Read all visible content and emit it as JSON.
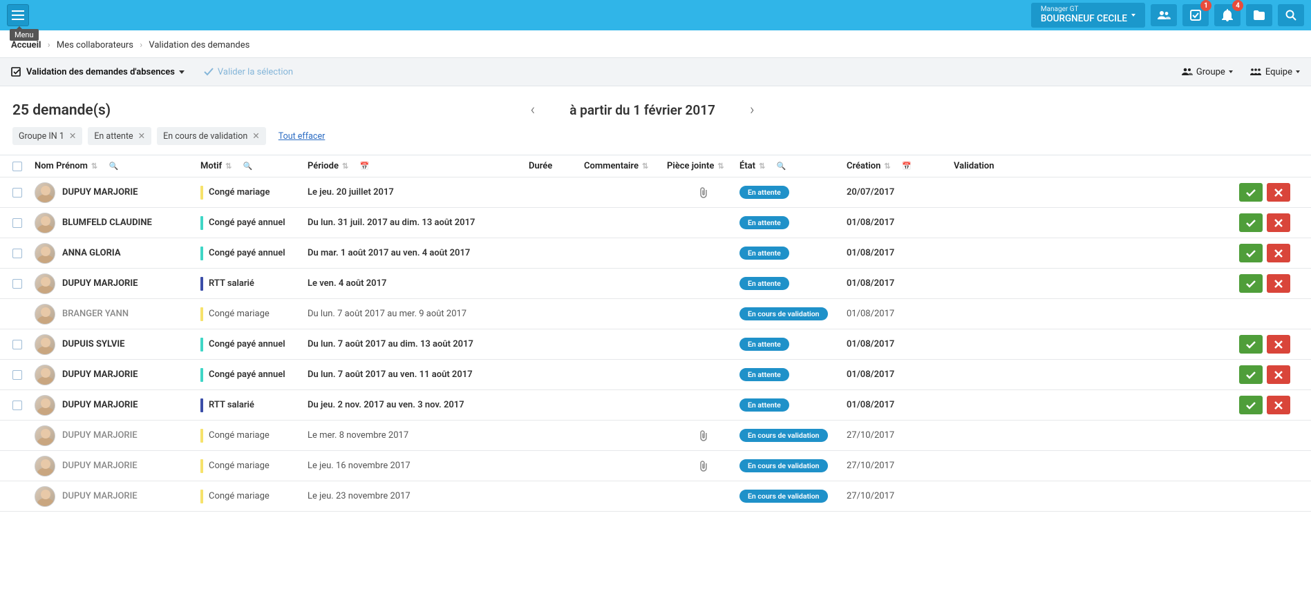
{
  "tooltip_menu": "Menu",
  "user": {
    "role": "Manager GT",
    "name": "BOURGNEUF CECILE"
  },
  "notif_badges": {
    "messages": "1",
    "bell": "4"
  },
  "breadcrumb": [
    "Accueil",
    "Mes collaborateurs",
    "Validation des demandes"
  ],
  "toolbar": {
    "main_action": "Validation des demandes d'absences",
    "validate_selection": "Valider la sélection",
    "group": "Groupe",
    "team": "Equipe"
  },
  "count_title": "25 demande(s)",
  "date_label": "à partir du 1 février 2017",
  "chips": [
    "Groupe IN 1",
    "En attente",
    "En cours de validation"
  ],
  "clear_all": "Tout effacer",
  "columns": {
    "name": "Nom Prénom",
    "motif": "Motif",
    "period": "Période",
    "duration": "Durée",
    "comment": "Commentaire",
    "attachment": "Pièce jointe",
    "state": "État",
    "creation": "Création",
    "validation": "Validation"
  },
  "status": {
    "pending": {
      "label": "En attente",
      "bg": "#1f91c9"
    },
    "inprogress": {
      "label": "En cours de validation",
      "bg": "#1f91c9"
    }
  },
  "motif_colors": {
    "conge_mariage": "#f6e26b",
    "conge_paye": "#3fd6c6",
    "rtt": "#3b4ea8"
  },
  "rows": [
    {
      "selectable": true,
      "name": "DUPUY MARJORIE",
      "motif": "Congé mariage",
      "motif_color": "conge_mariage",
      "period": "Le jeu. 20 juillet 2017",
      "attach": true,
      "status": "pending",
      "date": "20/07/2017",
      "actions": true,
      "bold": true
    },
    {
      "selectable": true,
      "name": "BLUMFELD CLAUDINE",
      "motif": "Congé payé annuel",
      "motif_color": "conge_paye",
      "period": "Du lun. 31 juil. 2017 au dim. 13 août 2017",
      "attach": false,
      "status": "pending",
      "date": "01/08/2017",
      "actions": true,
      "bold": true
    },
    {
      "selectable": true,
      "name": "ANNA GLORIA",
      "motif": "Congé payé annuel",
      "motif_color": "conge_paye",
      "period": "Du mar. 1 août 2017 au ven. 4 août 2017",
      "attach": false,
      "status": "pending",
      "date": "01/08/2017",
      "actions": true,
      "bold": true
    },
    {
      "selectable": true,
      "name": "DUPUY MARJORIE",
      "motif": "RTT salarié",
      "motif_color": "rtt",
      "period": "Le ven. 4 août 2017",
      "attach": false,
      "status": "pending",
      "date": "01/08/2017",
      "actions": true,
      "bold": true
    },
    {
      "selectable": false,
      "name": "BRANGER YANN",
      "motif": "Congé mariage",
      "motif_color": "conge_mariage",
      "period": "Du lun. 7 août 2017 au mer. 9 août 2017",
      "attach": false,
      "status": "inprogress",
      "date": "01/08/2017",
      "actions": false,
      "bold": false
    },
    {
      "selectable": true,
      "name": "DUPUIS SYLVIE",
      "motif": "Congé payé annuel",
      "motif_color": "conge_paye",
      "period": "Du lun. 7 août 2017 au dim. 13 août 2017",
      "attach": false,
      "status": "pending",
      "date": "01/08/2017",
      "actions": true,
      "bold": true
    },
    {
      "selectable": true,
      "name": "DUPUY MARJORIE",
      "motif": "Congé payé annuel",
      "motif_color": "conge_paye",
      "period": "Du lun. 7 août 2017 au ven. 11 août 2017",
      "attach": false,
      "status": "pending",
      "date": "01/08/2017",
      "actions": true,
      "bold": true
    },
    {
      "selectable": true,
      "name": "DUPUY MARJORIE",
      "motif": "RTT salarié",
      "motif_color": "rtt",
      "period": "Du jeu. 2 nov. 2017 au ven. 3 nov. 2017",
      "attach": false,
      "status": "pending",
      "date": "01/08/2017",
      "actions": true,
      "bold": true
    },
    {
      "selectable": false,
      "name": "DUPUY MARJORIE",
      "motif": "Congé mariage",
      "motif_color": "conge_mariage",
      "period": "Le mer. 8 novembre 2017",
      "attach": true,
      "status": "inprogress",
      "date": "27/10/2017",
      "actions": false,
      "bold": false
    },
    {
      "selectable": false,
      "name": "DUPUY MARJORIE",
      "motif": "Congé mariage",
      "motif_color": "conge_mariage",
      "period": "Le jeu. 16 novembre 2017",
      "attach": true,
      "status": "inprogress",
      "date": "27/10/2017",
      "actions": false,
      "bold": false
    },
    {
      "selectable": false,
      "name": "DUPUY MARJORIE",
      "motif": "Congé mariage",
      "motif_color": "conge_mariage",
      "period": "Le jeu. 23 novembre 2017",
      "attach": false,
      "status": "inprogress",
      "date": "27/10/2017",
      "actions": false,
      "bold": false
    }
  ]
}
